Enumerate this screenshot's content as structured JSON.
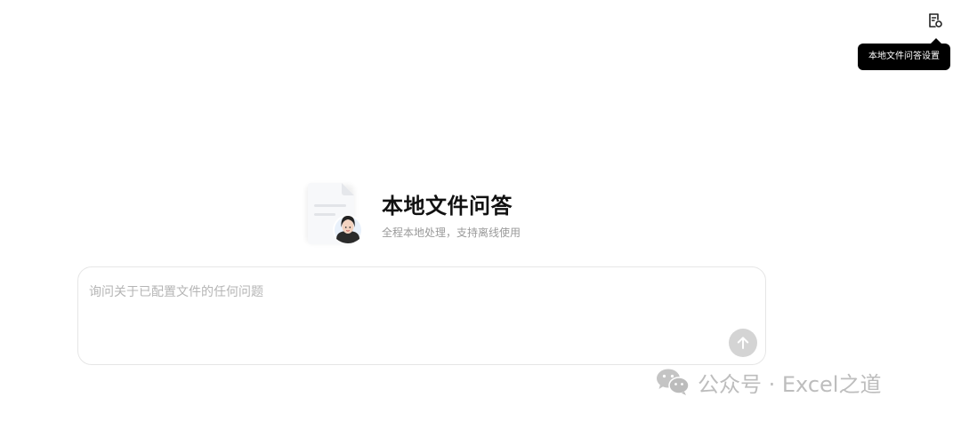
{
  "header": {
    "settings_icon": "file-settings-icon",
    "settings_tooltip": "本地文件问答设置"
  },
  "hero": {
    "icon": "document-avatar-icon",
    "title": "本地文件问答",
    "subtitle": "全程本地处理，支持离线使用"
  },
  "chat": {
    "placeholder": "询问关于已配置文件的任何问题",
    "value": "",
    "send_icon": "arrow-up-icon"
  },
  "watermark": {
    "icon": "wechat-icon",
    "text": "公众号 · Excel之道"
  },
  "colors": {
    "tooltip_bg": "#000000",
    "send_button": "#d4d4d4",
    "subtitle": "#9a9a9a",
    "placeholder": "#b5b5b5"
  }
}
